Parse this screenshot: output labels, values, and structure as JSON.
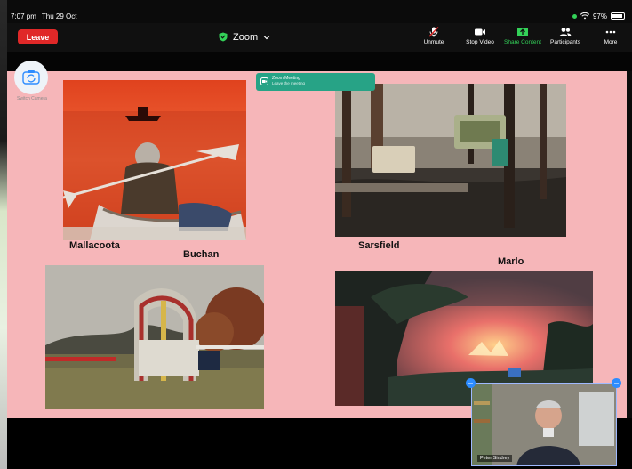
{
  "status": {
    "time": "7:07 pm",
    "date": "Thu 29 Oct",
    "battery": "97%"
  },
  "toolbar": {
    "leave_label": "Leave",
    "title": "Zoom",
    "items": [
      {
        "label": "Unmute",
        "icon": "mic-muted-icon"
      },
      {
        "label": "Stop Video",
        "icon": "video-camera-icon"
      },
      {
        "label": "Share Content",
        "icon": "share-screen-icon"
      },
      {
        "label": "Participants",
        "icon": "participants-icon"
      },
      {
        "label": "More",
        "icon": "more-dots-icon"
      }
    ]
  },
  "switch_camera": {
    "label": "Switch Camera"
  },
  "toast": {
    "line1": "Zoom Meeting",
    "line2": "Leave the meeting"
  },
  "slide": {
    "captions": [
      "Mallacoota",
      "Buchan",
      "Sarsfield",
      "Marlo"
    ]
  },
  "self_view": {
    "name": "Peter Sindrey"
  },
  "colors": {
    "leave": "#e02828",
    "share_accent": "#33d158",
    "slide_bg": "#f6b6b9",
    "toast": "#27a386"
  }
}
